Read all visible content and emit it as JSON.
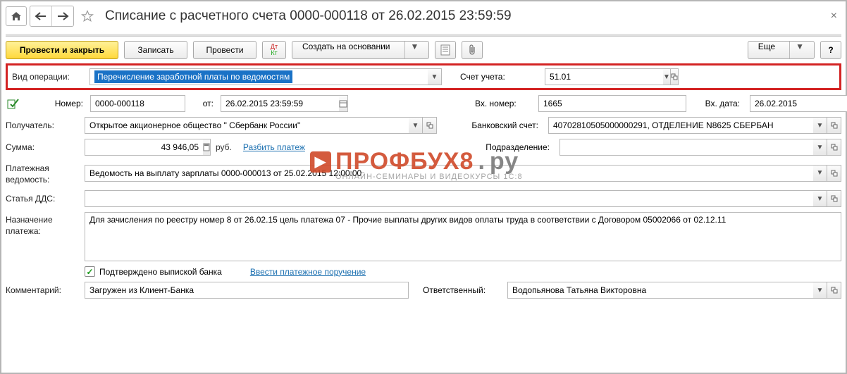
{
  "header": {
    "title": "Списание с расчетного счета 0000-000118 от 26.02.2015 23:59:59"
  },
  "toolbar": {
    "post_close": "Провести и закрыть",
    "save": "Записать",
    "post": "Провести",
    "create_based": "Создать на основании",
    "more": "Еще"
  },
  "fields": {
    "operation_type_label": "Вид операции:",
    "operation_type_value": "Перечисление заработной платы по ведомостям",
    "number_label": "Номер:",
    "number_value": "0000-000118",
    "from_label": "от:",
    "date_value": "26.02.2015 23:59:59",
    "account_label": "Счет учета:",
    "account_value": "51.01",
    "in_no_label": "Вх. номер:",
    "in_no_value": "1665",
    "in_date_label": "Вх. дата:",
    "in_date_value": "26.02.2015",
    "recipient_label": "Получатель:",
    "recipient_value": "Открытое акционерное общество \" Сбербанк России\"",
    "bank_acct_label": "Банковский счет:",
    "bank_acct_value": "40702810505000000291, ОТДЕЛЕНИЕ N8625 СБЕРБАН",
    "sum_label": "Сумма:",
    "sum_value": "43 946,05",
    "sum_currency": "руб.",
    "split_link": "Разбить платеж",
    "dept_label": "Подразделение:",
    "dept_value": "",
    "sheet_label": "Платежная ведомость:",
    "sheet_value": "Ведомость на выплату зарплаты 0000-000013 от 25.02.2015 12:00:00",
    "dds_label": "Статья ДДС:",
    "dds_value": "",
    "purpose_label": "Назначение платежа:",
    "purpose_value": "Для зачисления по реестру номер 8 от 26.02.15 цель платежа 07 - Прочие выплаты других видов оплаты труда в соответствии с Договором 05002066 от 02.12.11",
    "confirmed_label": "Подтверждено выпиской банка",
    "enter_order_link": "Ввести платежное поручение",
    "comment_label": "Комментарий:",
    "comment_value": "Загружен из Клиент-Банка",
    "responsible_label": "Ответственный:",
    "responsible_value": "Водопьянова Татьяна Викторовна"
  },
  "watermark": {
    "line1a": "ПРОФБУХ8",
    "line1b": "ру",
    "line2": "ОНЛАЙН-СЕМИНАРЫ И ВИДЕОКУРСЫ 1С:8"
  }
}
